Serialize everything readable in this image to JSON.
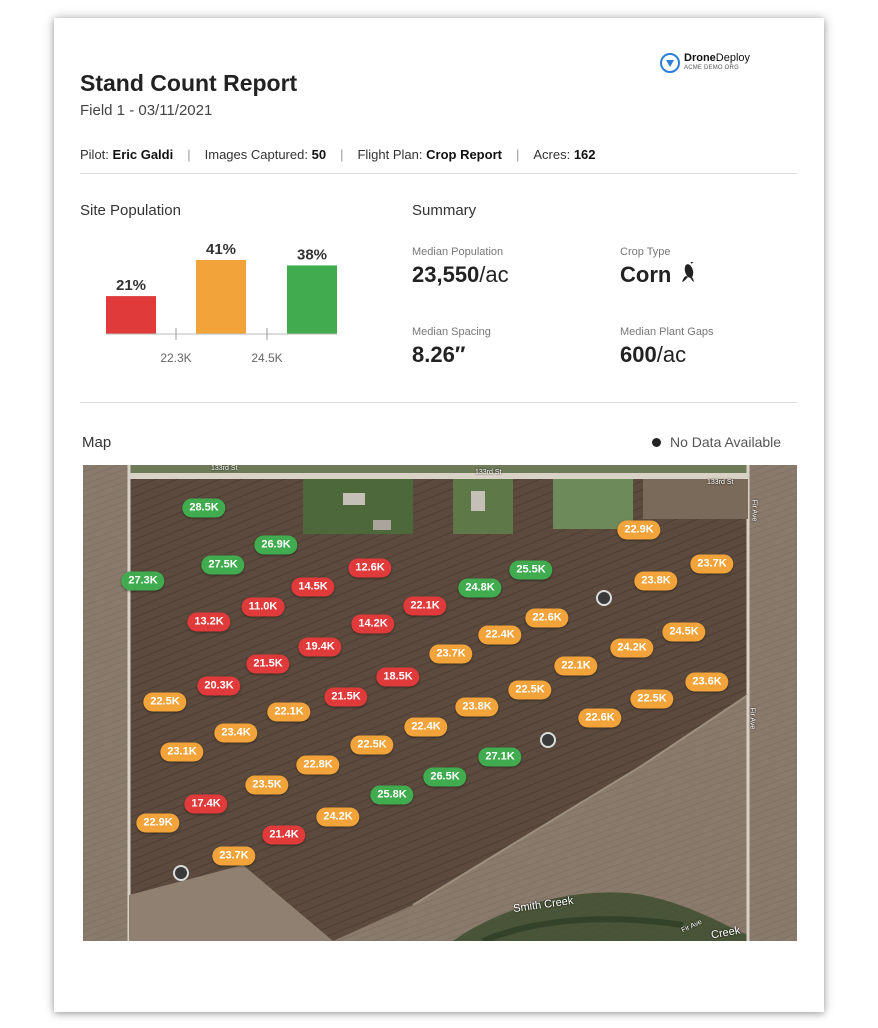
{
  "header": {
    "title": "Stand Count Report",
    "subtitle": "Field 1 - 03/11/2021",
    "logo": {
      "brand_bold": "Drone",
      "brand_rest": "Deploy",
      "org": "ACME DEMO ORG",
      "icon": "dronedeploy-logo-icon",
      "color": "#2d7fd6"
    }
  },
  "meta": {
    "pilot_label": "Pilot:",
    "pilot": "Eric Galdi",
    "images_label": "Images Captured:",
    "images": "50",
    "plan_label": "Flight Plan:",
    "plan": "Crop Report",
    "acres_label": "Acres:",
    "acres": "162",
    "separator": "|"
  },
  "population": {
    "label": "Site Population",
    "chart_data": {
      "type": "bar",
      "categories": [
        "below 22.3K",
        "22.3K–24.5K",
        "above 24.5K"
      ],
      "values": [
        21,
        41,
        38
      ],
      "value_labels": [
        "21%",
        "41%",
        "38%"
      ],
      "colors": [
        "#e03a3a",
        "#f2a33a",
        "#41ac4f"
      ],
      "tick_labels": [
        "22.3K",
        "24.5K"
      ],
      "ylim": [
        0,
        45
      ]
    }
  },
  "summary": {
    "label": "Summary",
    "median_population_label": "Median Population",
    "median_population": "23,550",
    "median_population_unit": "/ac",
    "crop_type_label": "Crop Type",
    "crop_type": "Corn",
    "crop_icon": "corn-icon",
    "median_spacing_label": "Median Spacing",
    "median_spacing": "8.26″",
    "median_gaps_label": "Median Plant Gaps",
    "median_gaps": "600",
    "median_gaps_unit": "/ac"
  },
  "map": {
    "label": "Map",
    "legend_no_data": "No Data Available",
    "roads": [
      "133rd St",
      "133rd St",
      "133rd St",
      "Fir Ave",
      "Fir Ave",
      "Fir Ave"
    ],
    "creek": [
      "Smith Creek",
      "Creek"
    ],
    "markers": [
      {
        "label": "28.5K",
        "status": "green"
      },
      {
        "label": "26.9K",
        "status": "green"
      },
      {
        "label": "27.5K",
        "status": "green"
      },
      {
        "label": "27.3K",
        "status": "green"
      },
      {
        "label": "12.6K",
        "status": "red"
      },
      {
        "label": "14.5K",
        "status": "red"
      },
      {
        "label": "11.0K",
        "status": "red"
      },
      {
        "label": "13.2K",
        "status": "red"
      },
      {
        "label": "22.1K",
        "status": "red"
      },
      {
        "label": "14.2K",
        "status": "red"
      },
      {
        "label": "19.4K",
        "status": "red"
      },
      {
        "label": "21.5K",
        "status": "red"
      },
      {
        "label": "20.3K",
        "status": "red"
      },
      {
        "label": "18.5K",
        "status": "red"
      },
      {
        "label": "21.5K",
        "status": "red"
      },
      {
        "label": "17.4K",
        "status": "red"
      },
      {
        "label": "21.4K",
        "status": "red"
      },
      {
        "label": "22.9K",
        "status": "orange"
      },
      {
        "label": "23.7K",
        "status": "orange"
      },
      {
        "label": "23.8K",
        "status": "orange"
      },
      {
        "label": "24.5K",
        "status": "orange"
      },
      {
        "label": "24.2K",
        "status": "orange"
      },
      {
        "label": "22.6K",
        "status": "orange"
      },
      {
        "label": "22.4K",
        "status": "orange"
      },
      {
        "label": "23.7K",
        "status": "orange"
      },
      {
        "label": "22.1K",
        "status": "orange"
      },
      {
        "label": "23.6K",
        "status": "orange"
      },
      {
        "label": "22.5K",
        "status": "orange"
      },
      {
        "label": "22.5K",
        "status": "orange"
      },
      {
        "label": "22.6K",
        "status": "orange"
      },
      {
        "label": "23.8K",
        "status": "orange"
      },
      {
        "label": "22.5K",
        "status": "orange"
      },
      {
        "label": "22.1K",
        "status": "orange"
      },
      {
        "label": "23.4K",
        "status": "orange"
      },
      {
        "label": "22.4K",
        "status": "orange"
      },
      {
        "label": "23.1K",
        "status": "orange"
      },
      {
        "label": "22.5K",
        "status": "orange"
      },
      {
        "label": "22.8K",
        "status": "orange"
      },
      {
        "label": "23.5K",
        "status": "orange"
      },
      {
        "label": "24.2K",
        "status": "orange"
      },
      {
        "label": "22.9K",
        "status": "orange"
      },
      {
        "label": "23.7K",
        "status": "orange"
      },
      {
        "label": "24.8K",
        "status": "green"
      },
      {
        "label": "25.5K",
        "status": "green"
      },
      {
        "label": "27.1K",
        "status": "green"
      },
      {
        "label": "26.5K",
        "status": "green"
      },
      {
        "label": "25.8K",
        "status": "green"
      }
    ],
    "status_colors": {
      "red": "#e03a3a",
      "orange": "#f2a33a",
      "green": "#41ac4f"
    }
  }
}
